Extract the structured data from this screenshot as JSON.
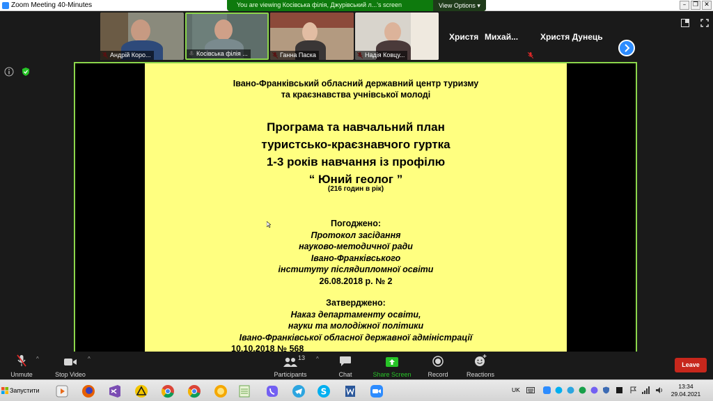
{
  "window": {
    "title": "Zoom Meeting 40-Minutes",
    "minimize": "–",
    "restore": "❐",
    "close": "✕"
  },
  "share_banner": {
    "message": "You are viewing Косівська філія, Джурівський л...'s screen",
    "view_options": "View Options ▾"
  },
  "participants": [
    {
      "name": "Андрій Коро..."
    },
    {
      "name": "Косівська філія ..."
    },
    {
      "name": "Ганна Паска"
    },
    {
      "name": "Надія Ковцу..."
    },
    {
      "name": "Христя"
    },
    {
      "name": "Михай..."
    },
    {
      "name": "Христя Дунець"
    }
  ],
  "slide": {
    "org_line1": "Івано-Франківський обласний державний центр туризму",
    "org_line2": "та краєзнавства учнівської молоді",
    "title_line1": "Програма та навчальний план",
    "title_line2": "туристсько-краєзнавчого гуртка",
    "title_line3": "1-3 років навчання із профілю",
    "title_line4": "“ Юний геолог ”",
    "hours": "(216 годин в рік)",
    "agreed_heading": "Погоджено:",
    "agreed_line1": "Протокол засідання",
    "agreed_line2": "науково-методичної ради",
    "agreed_line3": "Івано-Франківського",
    "agreed_line4": "інституту післядипломної освіти",
    "agreed_date": "26.08.2018 р. № 2",
    "approved_heading": "Затверджено:",
    "approved_line1": "Наказ департаменту освіти,",
    "approved_line2": "науки та молодіжної політики",
    "approved_line3": "Івано-Франківської обласної державної адміністрації",
    "approved_date": "10.10.2018 № 568"
  },
  "toolbar": {
    "unmute": "Unmute",
    "stop_video": "Stop Video",
    "participants": "Participants",
    "participants_count": "13",
    "chat": "Chat",
    "share_screen": "Share Screen",
    "record": "Record",
    "reactions": "Reactions",
    "leave": "Leave"
  },
  "taskbar": {
    "start": "Запустити",
    "language": "UK",
    "time": "13:34",
    "date": "29.04.2021"
  },
  "colors": {
    "slide_background": "#ffff80",
    "share_banner": "#0e7a0d",
    "stage_border": "#8cd64b",
    "share_screen_icon": "#27c427",
    "leave_button": "#c7271c",
    "accent_blue": "#2d8cff"
  }
}
